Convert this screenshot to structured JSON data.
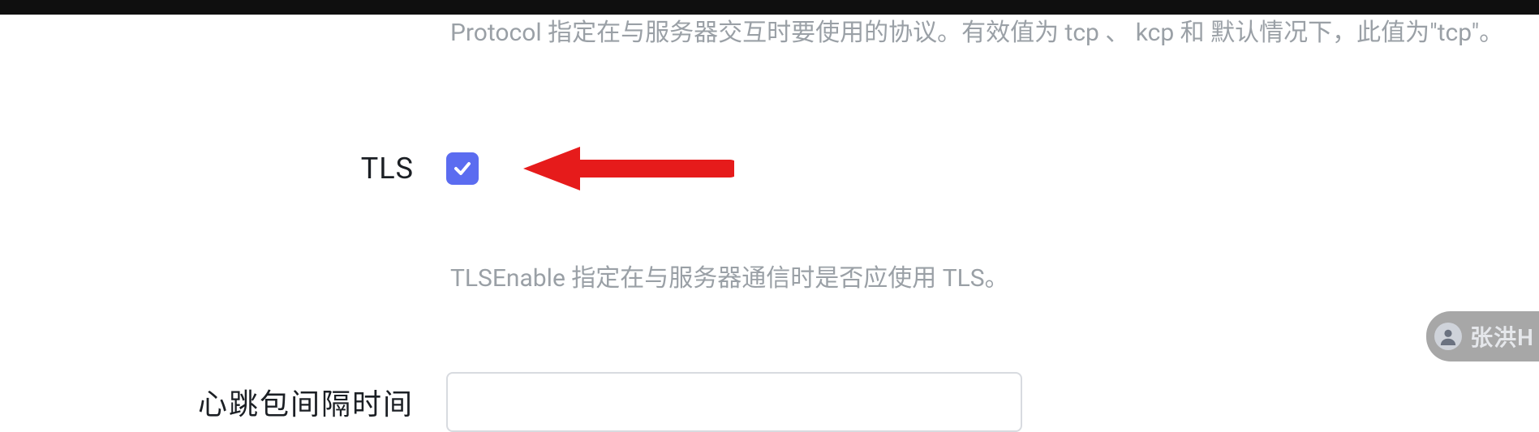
{
  "protocol": {
    "description": "Protocol 指定在与服务器交互时要使用的协议。有效值为 tcp 、 kcp 和 默认情况下，此值为\"tcp\"。"
  },
  "tls": {
    "label": "TLS",
    "checked": true,
    "description": "TLSEnable 指定在与服务器通信时是否应使用 TLS。"
  },
  "heartbeat": {
    "label": "心跳包间隔时间",
    "value": ""
  },
  "watermark": {
    "text": "张洪H"
  }
}
